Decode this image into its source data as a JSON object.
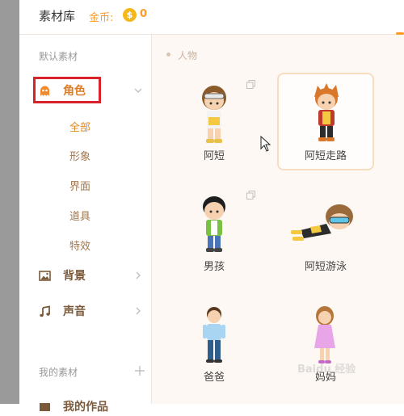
{
  "header": {
    "title": "素材库",
    "coin_label": "金币:",
    "coin_symbol": "$",
    "coin_count": "0"
  },
  "sidebar": {
    "default_section": "默认素材",
    "categories": [
      {
        "label": "角色",
        "icon": "ghost-icon",
        "active": true,
        "expanded": true
      },
      {
        "label": "背景",
        "icon": "image-icon"
      },
      {
        "label": "声音",
        "icon": "music-note-icon"
      }
    ],
    "subcategories": [
      {
        "label": "全部",
        "active": true
      },
      {
        "label": "形象"
      },
      {
        "label": "界面"
      },
      {
        "label": "道具"
      },
      {
        "label": "特效"
      }
    ],
    "my_section": "我的素材",
    "my_item_partial": "我的作品"
  },
  "content": {
    "group_label": "人物",
    "items": [
      {
        "name": "阿短",
        "multi": true
      },
      {
        "name": "阿短走路",
        "selected": true
      },
      {
        "name": "男孩",
        "multi": true
      },
      {
        "name": "阿短游泳"
      },
      {
        "name": "爸爸"
      },
      {
        "name": "妈妈"
      }
    ]
  },
  "colors": {
    "accent": "#ff9c26",
    "active_text": "#e07d22",
    "highlight_box": "#d8232a",
    "content_bg": "#fdf8f3"
  },
  "watermark": "Baidu 经验"
}
